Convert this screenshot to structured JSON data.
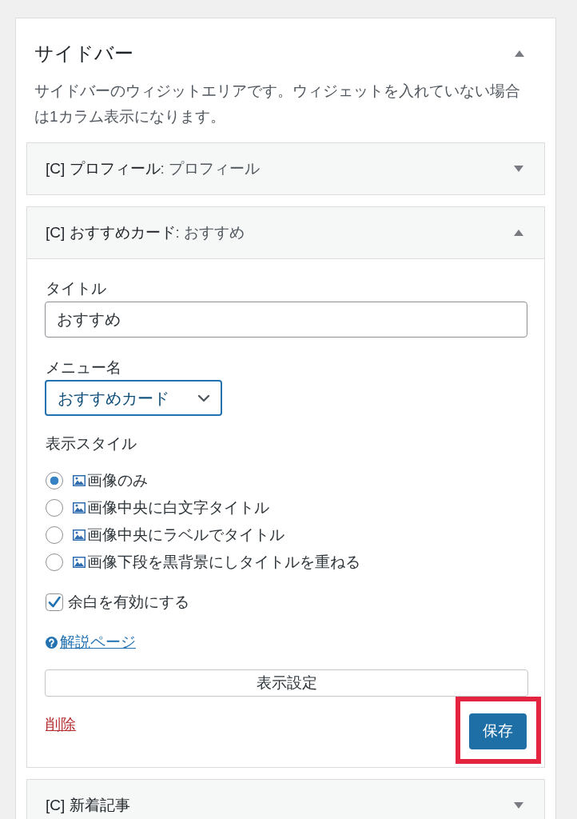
{
  "sidebar": {
    "title": "サイドバー",
    "expanded": true,
    "description": "サイドバーのウィジットエリアです。ウィジェットを入れていない場合は1カラム表示になります。",
    "widgets": [
      {
        "title": "[C] プロフィール",
        "in_title": ": プロフィール",
        "expanded": false
      },
      {
        "title": "[C] おすすめカード",
        "in_title": ": おすすめ",
        "expanded": true,
        "form": {
          "fields": [
            {
              "kind": "text",
              "label": "タイトル",
              "value": "おすすめ"
            },
            {
              "kind": "select",
              "label": "メニュー名",
              "value": "おすすめカード",
              "focused": true
            }
          ],
          "style_group": {
            "label": "表示スタイル",
            "options": [
              {
                "label": "画像のみ",
                "selected": true
              },
              {
                "label": "画像中央に白文字タイトル",
                "selected": false
              },
              {
                "label": "画像中央にラベルでタイトル",
                "selected": false
              },
              {
                "label": "画像下段を黒背景にしタイトルを重ねる",
                "selected": false
              }
            ]
          },
          "margin_option": {
            "label": "余白を有効にする",
            "checked": true
          },
          "help_link": "解説ページ",
          "settings_button": "表示設定",
          "delete_link": "削除",
          "save_button": {
            "label": "保存",
            "highlighted": true
          }
        }
      },
      {
        "title": "[C] 新着記事",
        "expanded": false
      }
    ]
  }
}
